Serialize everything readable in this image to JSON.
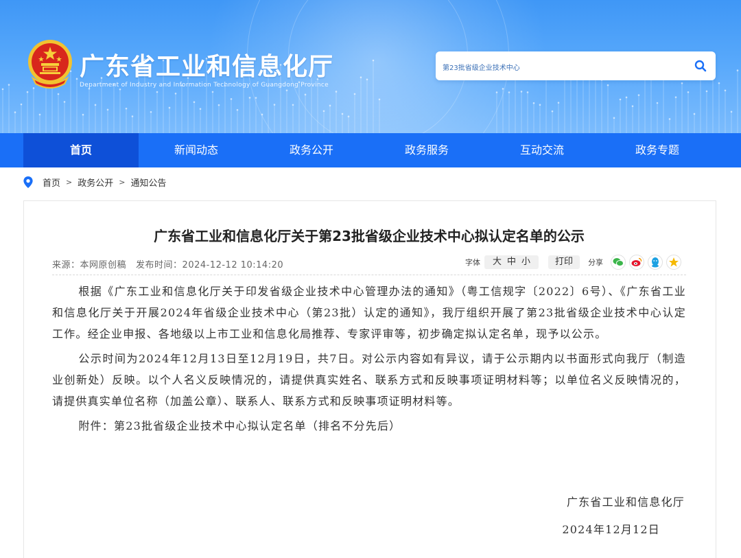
{
  "header": {
    "site_title": "广东省工业和信息化厅",
    "site_subtitle": "Department of Industry and Information Technology of Guangdong Province",
    "search": {
      "value": "第23批省级企业技术中心"
    }
  },
  "nav": {
    "items": [
      {
        "label": "首页",
        "active": true
      },
      {
        "label": "新闻动态"
      },
      {
        "label": "政务公开"
      },
      {
        "label": "政务服务"
      },
      {
        "label": "互动交流"
      },
      {
        "label": "政务专题"
      }
    ]
  },
  "breadcrumb": {
    "items": [
      "首页",
      "政务公开",
      "通知公告"
    ],
    "separator": ">"
  },
  "article": {
    "title": "广东省工业和信息化厅关于第23批省级企业技术中心拟认定名单的公示",
    "source_label": "来源：",
    "source": "本网原创稿",
    "time_label": "发布时间：",
    "time": "2024-12-12 10:14:20",
    "tools": {
      "font_label": "字体",
      "font_sizes": [
        "大",
        "中",
        "小"
      ],
      "print_label": "打印",
      "share_label": "分享",
      "share_icons": [
        "wechat-icon",
        "weibo-icon",
        "qq-icon",
        "qzone-icon"
      ]
    },
    "paragraphs": [
      "根据《广东工业和信息化厅关于印发省级企业技术中心管理办法的通知》（粤工信规字〔2022〕6号）、《广东省工业和信息化厅关于开展2024年省级企业技术中心（第23批）认定的通知》，我厅组织开展了第23批省级企业技术中心认定工作。经企业申报、各地级以上市工业和信息化局推荐、专家评审等，初步确定拟认定名单，现予以公示。",
      "公示时间为2024年12月13日至12月19日，共7日。对公示内容如有异议，请于公示期内以书面形式向我厅（制造业创新处）反映。以个人名义反映情况的，请提供真实姓名、联系方式和反映事项证明材料等；以单位名义反映情况的，请提供真实单位名称（加盖公章）、联系人、联系方式和反映事项证明材料等。"
    ],
    "attachment_label": "附件：",
    "attachment": "第23批省级企业技术中心拟认定名单（排名不分先后）",
    "signature_org": "广东省工业和信息化厅",
    "signature_date": "2024年12月12日"
  },
  "colors": {
    "nav_bg": "#1a6ff7",
    "nav_active": "#0e50d8",
    "banner": "#4a9ff8"
  }
}
